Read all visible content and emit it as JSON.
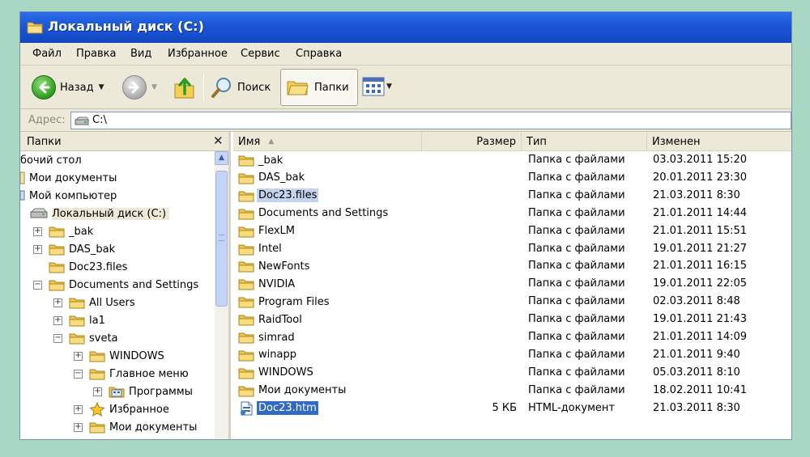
{
  "window": {
    "title": "Локальный диск (C:)"
  },
  "menu": [
    "Файл",
    "Правка",
    "Вид",
    "Избранное",
    "Сервис",
    "Справка"
  ],
  "toolbar": {
    "back_label": "Назад",
    "search_label": "Поиск",
    "folders_label": "Папки"
  },
  "address": {
    "label": "Адрес:",
    "value": "C:\\"
  },
  "left_pane": {
    "title": "Папки",
    "close_glyph": "✕",
    "tree": [
      {
        "label": "бочий стол",
        "expander": "",
        "icon": "desktop-icon"
      },
      {
        "label": "Мои документы",
        "expander": "",
        "icon": "my-documents-icon"
      },
      {
        "label": "Мой компьютер",
        "expander": "",
        "icon": "my-computer-icon"
      },
      {
        "label": "Локальный диск (C:)",
        "expander": "",
        "icon": "drive-icon"
      },
      {
        "label": "_bak",
        "expander": "+",
        "icon": "folder-icon"
      },
      {
        "label": "DAS_bak",
        "expander": "+",
        "icon": "folder-icon"
      },
      {
        "label": "Doc23.files",
        "expander": "",
        "icon": "folder-icon"
      },
      {
        "label": "Documents and Settings",
        "expander": "−",
        "icon": "folder-icon"
      },
      {
        "label": "All Users",
        "expander": "+",
        "icon": "folder-icon"
      },
      {
        "label": "la1",
        "expander": "+",
        "icon": "folder-icon"
      },
      {
        "label": "sveta",
        "expander": "−",
        "icon": "folder-icon"
      },
      {
        "label": "WINDOWS",
        "expander": "+",
        "icon": "folder-icon"
      },
      {
        "label": "Главное меню",
        "expander": "−",
        "icon": "folder-icon"
      },
      {
        "label": "Программы",
        "expander": "+",
        "icon": "programs-folder-icon"
      },
      {
        "label": "Избранное",
        "expander": "+",
        "icon": "favorites-star-icon"
      },
      {
        "label": "Мои документы",
        "expander": "+",
        "icon": "folder-icon"
      }
    ]
  },
  "columns": {
    "name": "Имя",
    "size": "Размер",
    "type": "Тип",
    "modified": "Изменен"
  },
  "files": [
    {
      "name": "_bak",
      "size": "",
      "type": "Папка с файлами",
      "modified": "03.03.2011 15:20",
      "icon": "folder-icon"
    },
    {
      "name": "DAS_bak",
      "size": "",
      "type": "Папка с файлами",
      "modified": "20.01.2011 23:30",
      "icon": "folder-icon"
    },
    {
      "name": "Doc23.files",
      "size": "",
      "type": "Папка с файлами",
      "modified": "21.03.2011 8:30",
      "icon": "folder-icon"
    },
    {
      "name": "Documents and Settings",
      "size": "",
      "type": "Папка с файлами",
      "modified": "21.01.2011 14:44",
      "icon": "folder-icon"
    },
    {
      "name": "FlexLM",
      "size": "",
      "type": "Папка с файлами",
      "modified": "21.01.2011 15:51",
      "icon": "folder-icon"
    },
    {
      "name": "Intel",
      "size": "",
      "type": "Папка с файлами",
      "modified": "19.01.2011 21:27",
      "icon": "folder-icon"
    },
    {
      "name": "NewFonts",
      "size": "",
      "type": "Папка с файлами",
      "modified": "21.01.2011 16:15",
      "icon": "folder-icon"
    },
    {
      "name": "NVIDIA",
      "size": "",
      "type": "Папка с файлами",
      "modified": "19.01.2011 22:05",
      "icon": "folder-icon"
    },
    {
      "name": "Program Files",
      "size": "",
      "type": "Папка с файлами",
      "modified": "02.03.2011 8:48",
      "icon": "folder-icon"
    },
    {
      "name": "RaidTool",
      "size": "",
      "type": "Папка с файлами",
      "modified": "19.01.2011 21:43",
      "icon": "folder-icon"
    },
    {
      "name": "simrad",
      "size": "",
      "type": "Папка с файлами",
      "modified": "21.01.2011 14:09",
      "icon": "folder-icon"
    },
    {
      "name": "winapp",
      "size": "",
      "type": "Папка с файлами",
      "modified": "21.01.2011 9:40",
      "icon": "folder-icon"
    },
    {
      "name": "WINDOWS",
      "size": "",
      "type": "Папка с файлами",
      "modified": "05.03.2011 8:10",
      "icon": "folder-icon"
    },
    {
      "name": "Мои документы",
      "size": "",
      "type": "Папка с файлами",
      "modified": "18.02.2011 10:41",
      "icon": "folder-icon"
    },
    {
      "name": "Doc23.htm",
      "size": "5 КБ",
      "type": "HTML-документ",
      "modified": "21.03.2011 8:30",
      "icon": "html-document-icon"
    }
  ],
  "colors": {
    "titlebar": "#1d58d8",
    "chrome": "#ece9d8",
    "selection": "#316ac5",
    "selection_inactive": "#c4d3ed",
    "background": "#a8d8c4"
  }
}
